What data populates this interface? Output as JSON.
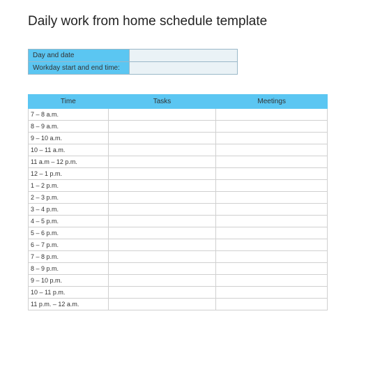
{
  "title": "Daily work from home schedule template",
  "info": {
    "day_label": "Day and date",
    "day_value": "",
    "time_label": "Workday start and end time:",
    "time_value": ""
  },
  "schedule": {
    "headers": {
      "time": "Time",
      "tasks": "Tasks",
      "meetings": "Meetings"
    },
    "rows": [
      {
        "time": "7 – 8 a.m.",
        "tasks": "",
        "meetings": ""
      },
      {
        "time": "8 – 9 a.m.",
        "tasks": "",
        "meetings": ""
      },
      {
        "time": "9 – 10 a.m.",
        "tasks": "",
        "meetings": ""
      },
      {
        "time": "10 – 11 a.m.",
        "tasks": "",
        "meetings": ""
      },
      {
        "time": "11 a.m – 12 p.m.",
        "tasks": "",
        "meetings": ""
      },
      {
        "time": "12 – 1 p.m.",
        "tasks": "",
        "meetings": ""
      },
      {
        "time": "1 – 2 p.m.",
        "tasks": "",
        "meetings": ""
      },
      {
        "time": "2 – 3 p.m.",
        "tasks": "",
        "meetings": ""
      },
      {
        "time": "3 – 4 p.m.",
        "tasks": "",
        "meetings": ""
      },
      {
        "time": "4 – 5 p.m.",
        "tasks": "",
        "meetings": ""
      },
      {
        "time": "5 – 6 p.m.",
        "tasks": "",
        "meetings": ""
      },
      {
        "time": "6 – 7 p.m.",
        "tasks": "",
        "meetings": ""
      },
      {
        "time": "7 – 8 p.m.",
        "tasks": "",
        "meetings": ""
      },
      {
        "time": "8 – 9 p.m.",
        "tasks": "",
        "meetings": ""
      },
      {
        "time": "9 – 10 p.m.",
        "tasks": "",
        "meetings": ""
      },
      {
        "time": "10 – 11 p.m.",
        "tasks": "",
        "meetings": ""
      },
      {
        "time": "11 p.m. – 12 a.m.",
        "tasks": "",
        "meetings": ""
      }
    ]
  }
}
